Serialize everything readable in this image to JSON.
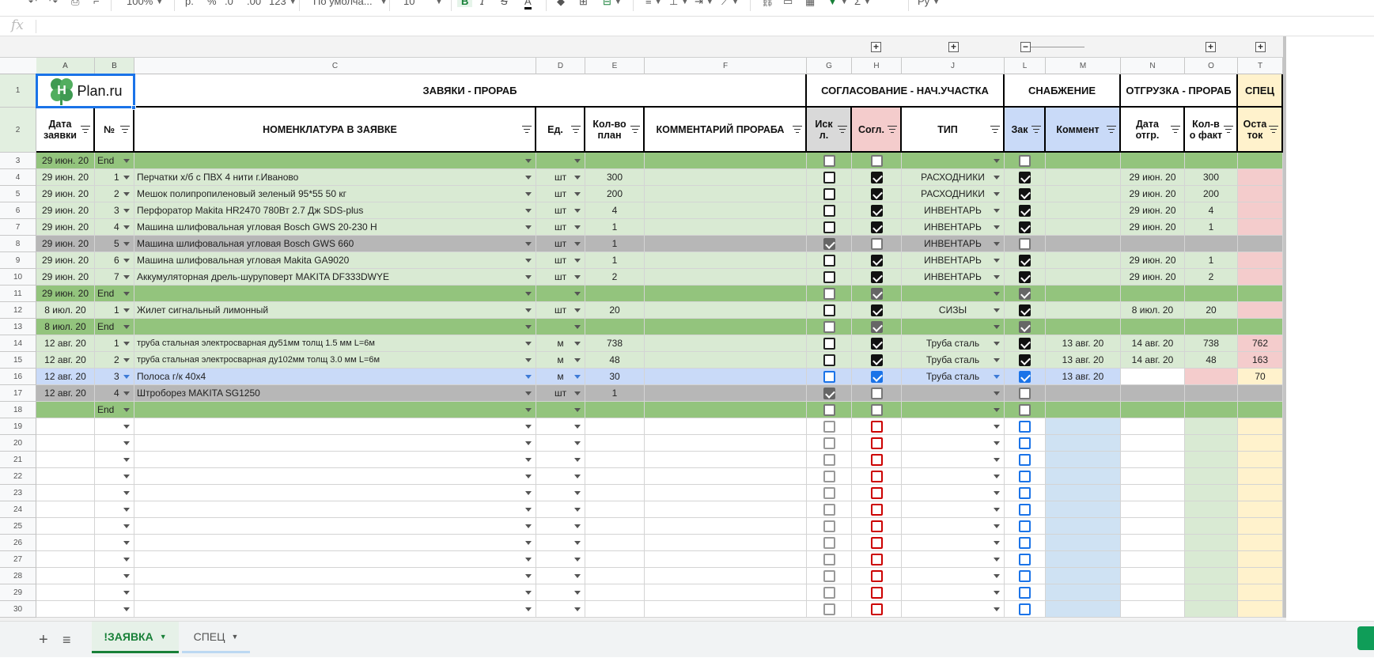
{
  "toolbar": {
    "zoom": "100%",
    "currency": "р.",
    "percent": "%",
    "dec_less": ".0",
    "dec_more": ".00",
    "num_format": "123",
    "font": "По умолча...",
    "font_size": "10",
    "bold": "B",
    "strike": "S",
    "text_color": "A"
  },
  "formula_bar": {
    "fx": "fx"
  },
  "column_letters": [
    "A",
    "B",
    "C",
    "D",
    "E",
    "F",
    "G",
    "H",
    "J",
    "L",
    "M",
    "N",
    "O",
    "T"
  ],
  "groups": {
    "collapsed_plus": "+",
    "expanded_minus": "−"
  },
  "logo": {
    "text": "Plan.ru",
    "mark": "H"
  },
  "headers": {
    "sections": {
      "requests": "ЗАВЯКИ - ПРОРАБ",
      "approval": "СОГЛАСОВАНИЕ - НАЧ.УЧАСТКА",
      "supply": "СНАБЖЕНИЕ",
      "shipment": "ОТГРУЗКА - ПРОРАБ",
      "spec": "СПЕЦ"
    },
    "columns": {
      "date": "Дата заявки",
      "num": "№",
      "nomen": "НОМЕНКЛАТУРА В ЗАЯВКЕ",
      "unit": "Ед.",
      "qty_plan": "Кол-во план",
      "comment": "КОММЕНТАРИЙ ПРОРАБА",
      "excl": "Иск л.",
      "agreed": "Согл.",
      "type": "ТИП",
      "order": "Зак",
      "supply_comment": "Коммент",
      "ship_date": "Дата отгр.",
      "qty_fact": "Кол-в о факт",
      "remainder": "Оста ток"
    }
  },
  "rows": [
    {
      "n": "3",
      "style": "end",
      "date": "29 июн. 20",
      "num": "End",
      "item": "",
      "unit": "",
      "qty": "",
      "excl": false,
      "agreed": false,
      "type": "",
      "order": false,
      "sc": "",
      "ship": "",
      "fact": "",
      "rem": ""
    },
    {
      "n": "4",
      "style": "ok",
      "date": "29 июн. 20",
      "num": "1",
      "item": "Перчатки х/б с ПВХ 4 нити г.Иваново",
      "unit": "шт",
      "qty": "300",
      "excl": false,
      "agreed": true,
      "type": "РАСХОДНИКИ",
      "order": true,
      "sc": "",
      "ship": "29 июн. 20",
      "fact": "300",
      "rem": ""
    },
    {
      "n": "5",
      "style": "ok",
      "date": "29 июн. 20",
      "num": "2",
      "item": "Мешок полипропиленовый зеленый 95*55 50 кг",
      "unit": "шт",
      "qty": "200",
      "excl": false,
      "agreed": true,
      "type": "РАСХОДНИКИ",
      "order": true,
      "sc": "",
      "ship": "29 июн. 20",
      "fact": "200",
      "rem": ""
    },
    {
      "n": "6",
      "style": "ok",
      "date": "29 июн. 20",
      "num": "3",
      "item": "Перфоратор Makita HR2470 780Вт 2.7 Дж SDS-plus",
      "unit": "шт",
      "qty": "4",
      "excl": false,
      "agreed": true,
      "type": "ИНВЕНТАРЬ",
      "order": true,
      "sc": "",
      "ship": "29 июн. 20",
      "fact": "4",
      "rem": ""
    },
    {
      "n": "7",
      "style": "ok",
      "date": "29 июн. 20",
      "num": "4",
      "item": "Машина шлифовальная угловая Bosch GWS 20-230 H",
      "unit": "шт",
      "qty": "1",
      "excl": false,
      "agreed": true,
      "type": "ИНВЕНТАРЬ",
      "order": true,
      "sc": "",
      "ship": "29 июн. 20",
      "fact": "1",
      "rem": ""
    },
    {
      "n": "8",
      "style": "excl",
      "date": "29 июн. 20",
      "num": "5",
      "item": "Машина шлифовальная угловая Bosch GWS 660",
      "unit": "шт",
      "qty": "1",
      "excl": true,
      "agreed": false,
      "type": "ИНВЕНТАРЬ",
      "order": false,
      "sc": "",
      "ship": "",
      "fact": "",
      "rem": ""
    },
    {
      "n": "9",
      "style": "ok",
      "date": "29 июн. 20",
      "num": "6",
      "item": "Машина шлифовальная угловая Makita GA9020",
      "unit": "шт",
      "qty": "1",
      "excl": false,
      "agreed": true,
      "type": "ИНВЕНТАРЬ",
      "order": true,
      "sc": "",
      "ship": "29 июн. 20",
      "fact": "1",
      "rem": ""
    },
    {
      "n": "10",
      "style": "ok",
      "date": "29 июн. 20",
      "num": "7",
      "item": "Аккумуляторная дрель-шуруповерт MAKITA DF333DWYE",
      "unit": "шт",
      "qty": "2",
      "excl": false,
      "agreed": true,
      "type": "ИНВЕНТАРЬ",
      "order": true,
      "sc": "",
      "ship": "29 июн. 20",
      "fact": "2",
      "rem": ""
    },
    {
      "n": "11",
      "style": "end",
      "date": "29 июн. 20",
      "num": "End",
      "item": "",
      "unit": "",
      "qty": "",
      "excl": false,
      "agreed": true,
      "type": "",
      "order": true,
      "sc": "",
      "ship": "",
      "fact": "",
      "rem": ""
    },
    {
      "n": "12",
      "style": "ok",
      "date": "8 июл. 20",
      "num": "1",
      "item": "Жилет сигнальный лимонный",
      "unit": "шт",
      "qty": "20",
      "excl": false,
      "agreed": true,
      "type": "СИЗЫ",
      "order": true,
      "sc": "",
      "ship": "8 июл. 20",
      "fact": "20",
      "rem": ""
    },
    {
      "n": "13",
      "style": "end",
      "date": "8 июл. 20",
      "num": "End",
      "item": "",
      "unit": "",
      "qty": "",
      "excl": false,
      "agreed": true,
      "type": "",
      "order": true,
      "sc": "",
      "ship": "",
      "fact": "",
      "rem": ""
    },
    {
      "n": "14",
      "style": "ok",
      "date": "12 авг. 20",
      "num": "1",
      "item": "труба стальная электросварная ду51мм толщ 1.5 мм L=6м",
      "unit": "м",
      "qty": "738",
      "excl": false,
      "agreed": true,
      "type": "Труба сталь",
      "order": true,
      "sc": "13 авг. 20",
      "ship": "14 авг. 20",
      "fact": "738",
      "rem": "762",
      "small": true
    },
    {
      "n": "15",
      "style": "ok",
      "date": "12 авг. 20",
      "num": "2",
      "item": "труба стальная электросварная ду102мм толщ 3.0 мм L=6м",
      "unit": "м",
      "qty": "48",
      "excl": false,
      "agreed": true,
      "type": "Труба сталь",
      "order": true,
      "sc": "13 авг. 20",
      "ship": "14 авг. 20",
      "fact": "48",
      "rem": "163",
      "small": true
    },
    {
      "n": "16",
      "style": "sel",
      "date": "12 авг. 20",
      "num": "3",
      "item": "Полоса г/к 40х4",
      "unit": "м",
      "qty": "30",
      "excl": false,
      "agreed": true,
      "type": "Труба сталь",
      "order": true,
      "sc": "13 авг. 20",
      "ship": "",
      "fact": "",
      "rem": "70"
    },
    {
      "n": "17",
      "style": "excl",
      "date": "12 авг. 20",
      "num": "4",
      "item": "Штроборез MAKITA SG1250",
      "unit": "шт",
      "qty": "1",
      "excl": true,
      "agreed": false,
      "type": "",
      "order": false,
      "sc": "",
      "ship": "",
      "fact": "",
      "rem": ""
    },
    {
      "n": "18",
      "style": "end",
      "date": "",
      "num": "End",
      "item": "",
      "unit": "",
      "qty": "",
      "excl": false,
      "agreed": false,
      "type": "",
      "order": false,
      "sc": "",
      "ship": "",
      "fact": "",
      "rem": ""
    }
  ],
  "empty_rows": [
    "19",
    "20",
    "21",
    "22",
    "23",
    "24",
    "25",
    "26",
    "27",
    "28",
    "29",
    "30"
  ],
  "sheet_tabs": {
    "add": "+",
    "list": "≡",
    "active": "!ЗАЯВКА",
    "second": "СПЕЦ"
  }
}
